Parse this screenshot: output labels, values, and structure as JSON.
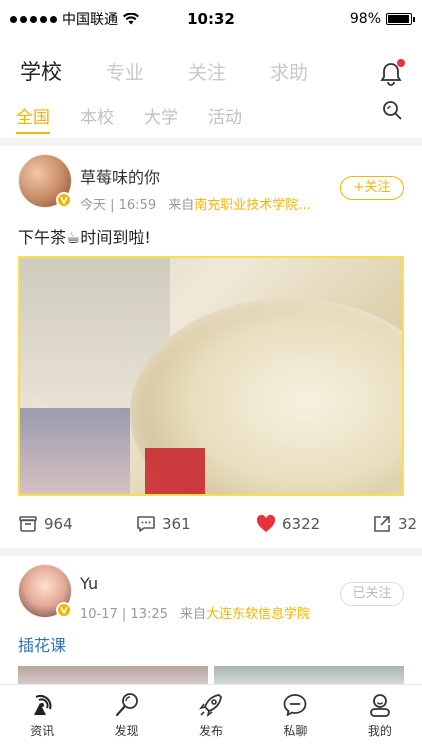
{
  "status_bar": {
    "carrier": "中国联通",
    "time": "10:32",
    "battery": "98%",
    "battery_level": 0.98
  },
  "top_tabs": [
    "学校",
    "专业",
    "关注",
    "求助"
  ],
  "sub_tabs": [
    "全国",
    "本校",
    "大学",
    "活动"
  ],
  "posts": [
    {
      "user": "草莓味的你",
      "time": "今天 | 16:59",
      "from": "来自",
      "school": "南充职业技术学院...",
      "follow": "+关注",
      "text": "下午茶☕时间到啦!",
      "actions": {
        "saves": "964",
        "comments": "361",
        "likes": "6322",
        "shares": "32"
      }
    },
    {
      "user": "Yu",
      "time": "10-17 | 13:25",
      "from": "来自",
      "school": "大连东软信息学院",
      "follow": "已关注",
      "text": "插花课"
    }
  ],
  "bottom_nav": [
    "资讯",
    "发现",
    "发布",
    "私聊",
    "我的"
  ],
  "colors": {
    "accent": "#f5b400",
    "like": "#e8323c",
    "link": "#2f73b7"
  }
}
